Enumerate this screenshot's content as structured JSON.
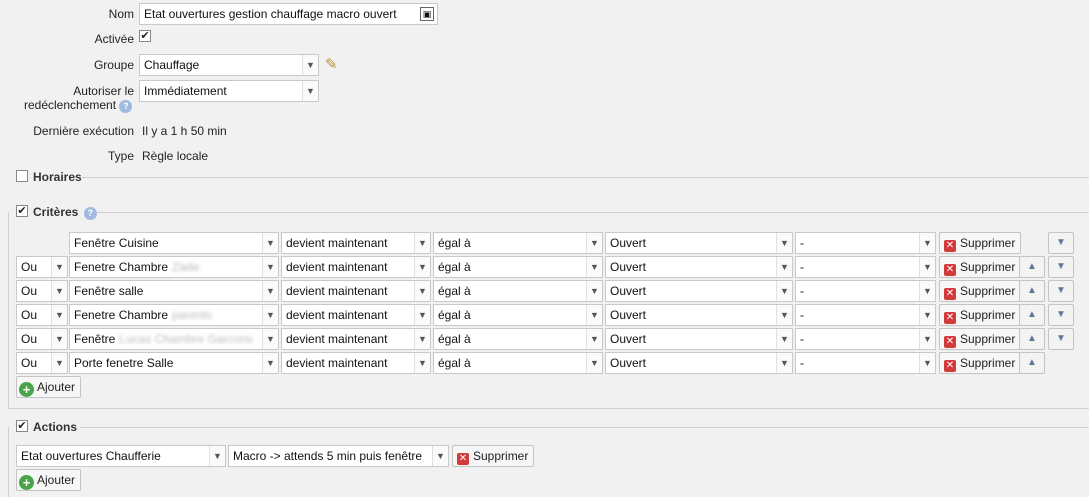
{
  "form": {
    "nom_label": "Nom",
    "nom_value": "Etat ouvertures gestion chauffage macro ouvert",
    "activee_label": "Activée",
    "groupe_label": "Groupe",
    "groupe_value": "Chauffage",
    "redecl_label_1": "Autoriser le",
    "redecl_label_2": "redéclenchement",
    "redecl_value": "Immédiatement",
    "derniere_label": "Dernière exécution",
    "derniere_value": "Il y a 1 h 50 min",
    "type_label": "Type",
    "type_value": "Règle locale"
  },
  "sections": {
    "horaires": "Horaires",
    "criteres": "Critères",
    "actions": "Actions"
  },
  "criteria": [
    {
      "logic": "",
      "device": "Fenêtre Cuisine",
      "device_blur": "",
      "event": "devient maintenant",
      "op": "égal à",
      "value": "Ouvert",
      "extra": "-"
    },
    {
      "logic": "Ou",
      "device": "Fenetre Chambre",
      "device_blur": "Zade",
      "event": "devient maintenant",
      "op": "égal à",
      "value": "Ouvert",
      "extra": "-"
    },
    {
      "logic": "Ou",
      "device": "Fenêtre salle",
      "device_blur": "",
      "event": "devient maintenant",
      "op": "égal à",
      "value": "Ouvert",
      "extra": "-"
    },
    {
      "logic": "Ou",
      "device": "Fenetre Chambre",
      "device_blur": "parents",
      "event": "devient maintenant",
      "op": "égal à",
      "value": "Ouvert",
      "extra": "-"
    },
    {
      "logic": "Ou",
      "device": "Fenêtre",
      "device_blur": "Lucas Chambre Garcons",
      "event": "devient maintenant",
      "op": "égal à",
      "value": "Ouvert",
      "extra": "-"
    },
    {
      "logic": "Ou",
      "device": "Porte fenetre Salle",
      "device_blur": "",
      "event": "devient maintenant",
      "op": "égal à",
      "value": "Ouvert",
      "extra": "-"
    }
  ],
  "buttons": {
    "delete": "Supprimer",
    "add": "Ajouter"
  },
  "action": {
    "target": "Etat ouvertures Chaufferie",
    "command": "Macro -> attends 5 min puis fenêtre"
  },
  "icons": {
    "dropdown": "▼",
    "up": "▲",
    "down": "▼",
    "check": "✔",
    "help": "?",
    "pencil": "✎",
    "delete": "✕",
    "add": "+"
  }
}
